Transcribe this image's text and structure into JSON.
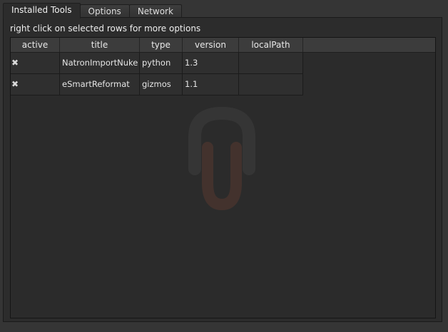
{
  "tabs": [
    {
      "label": "Installed Tools",
      "active": true
    },
    {
      "label": "Options",
      "active": false
    },
    {
      "label": "Network",
      "active": false
    }
  ],
  "hint": "right click on selected rows for more options",
  "table": {
    "columns": [
      "active",
      "title",
      "type",
      "version",
      "localPath"
    ],
    "rows": [
      {
        "active": "✖",
        "title": "NatronImportNuke",
        "type": "python",
        "version": "1.3",
        "localPath": ""
      },
      {
        "active": "✖",
        "title": "eSmartReformat",
        "type": "gizmos",
        "version": "1.1",
        "localPath": ""
      }
    ]
  },
  "colors": {
    "background": "#353535",
    "panel": "#2c2c2c",
    "logo_accent": "#c0583a"
  },
  "icons": {
    "active_mark": "close-x-icon",
    "watermark": "nuke-logo-icon"
  }
}
